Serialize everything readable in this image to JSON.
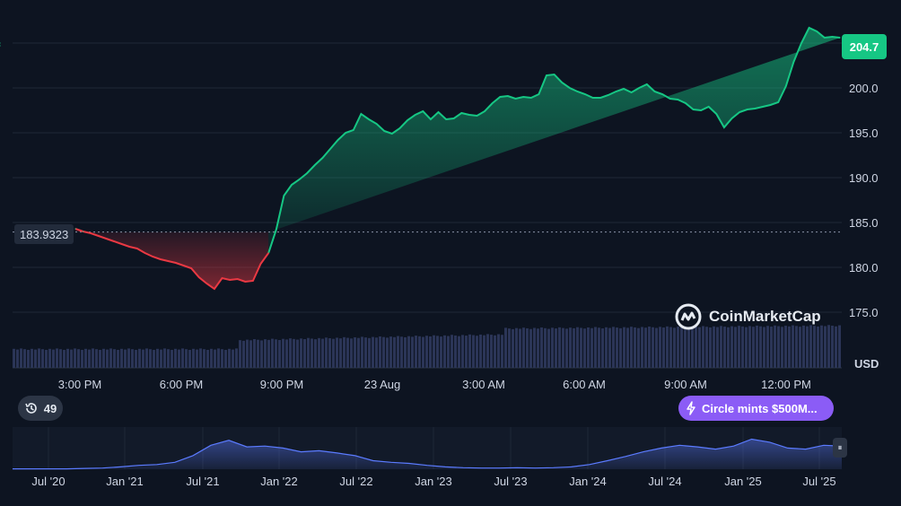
{
  "chart_data": {
    "type": "area",
    "title": "",
    "xlabel": "",
    "ylabel": "USD",
    "x_ticks": [
      "3:00 PM",
      "6:00 PM",
      "9:00 PM",
      "23 Aug",
      "3:00 AM",
      "6:00 AM",
      "9:00 AM",
      "12:00 PM"
    ],
    "y_ticks": [
      175.0,
      180.0,
      185.0,
      190.0,
      195.0,
      200.0
    ],
    "ylim": [
      172.0,
      206.5
    ],
    "baseline": 183.9323,
    "baseline_label": "183.9323",
    "current_price": 204.7,
    "current_price_label": "204.7",
    "grid": true,
    "colors": {
      "up": "#16c784",
      "down": "#ea3943",
      "volume": "#2e3a5e",
      "navigator": "#4a63c9"
    },
    "series": [
      {
        "name": "",
        "x_hours": [
          0,
          0.25,
          0.5,
          0.75,
          1,
          1.25,
          1.5,
          1.75,
          2,
          2.25,
          2.5,
          2.75,
          3,
          3.25,
          3.5,
          3.75,
          4,
          4.25,
          4.5,
          4.75,
          5,
          5.25,
          5.5,
          5.75,
          6,
          6.25,
          6.5,
          6.75,
          7,
          7.25,
          7.5,
          7.75,
          8,
          8.25,
          8.5,
          8.75,
          9,
          9.25,
          9.5,
          9.75,
          10,
          10.25,
          10.5,
          10.75,
          11,
          11.25,
          11.5,
          11.75,
          12,
          12.25,
          12.5,
          12.75,
          13,
          13.25,
          13.5,
          13.75,
          14,
          14.25,
          14.5,
          14.75,
          15,
          15.25,
          15.5,
          15.75,
          16,
          16.25,
          16.5,
          16.75,
          17,
          17.25,
          17.5,
          17.75,
          18,
          18.25,
          18.5,
          18.75,
          19,
          19.25,
          19.5,
          19.75,
          20,
          20.25,
          20.5,
          20.75,
          21,
          21.25,
          21.5,
          21.75,
          22,
          22.25,
          22.5,
          22.75,
          23,
          23.25,
          23.5,
          23.75,
          24,
          24.25,
          24.5,
          24.75
        ],
        "values": [
          184.3,
          184.0,
          183.8,
          183.5,
          183.2,
          182.9,
          182.6,
          182.3,
          182.1,
          181.6,
          181.2,
          180.9,
          180.7,
          180.5,
          180.2,
          179.9,
          178.9,
          178.2,
          177.6,
          178.8,
          178.6,
          178.7,
          178.4,
          178.5,
          180.4,
          181.6,
          184.2,
          188.0,
          189.2,
          189.8,
          190.5,
          191.4,
          192.2,
          193.2,
          194.2,
          195.0,
          195.3,
          197.1,
          196.5,
          196.0,
          195.2,
          194.9,
          195.5,
          196.4,
          197.0,
          197.4,
          196.5,
          197.3,
          196.5,
          196.6,
          197.2,
          197.0,
          196.9,
          197.4,
          198.3,
          199.0,
          199.1,
          198.8,
          199.0,
          198.9,
          199.3,
          201.4,
          201.5,
          200.6,
          200.0,
          199.6,
          199.3,
          198.9,
          198.9,
          199.2,
          199.6,
          199.9,
          199.5,
          200.0,
          200.4,
          199.6,
          199.3,
          198.8,
          198.7,
          198.3,
          197.6,
          197.5,
          197.9,
          197.1,
          195.6,
          196.6,
          197.3,
          197.6,
          197.7,
          197.9,
          198.1,
          198.4,
          200.2,
          202.9,
          205.0,
          206.7,
          206.3,
          205.6,
          205.7,
          205.6,
          205.0,
          204.7
        ]
      }
    ],
    "navigator": {
      "x_ticks": [
        "Jul '20",
        "Jan '21",
        "Jul '21",
        "Jan '22",
        "Jul '22",
        "Jan '23",
        "Jul '23",
        "Jan '24",
        "Jul '24",
        "Jan '25",
        "Jul '25"
      ],
      "values": [
        0.01,
        0.01,
        0.01,
        0.01,
        0.02,
        0.03,
        0.06,
        0.1,
        0.12,
        0.18,
        0.35,
        0.62,
        0.75,
        0.58,
        0.6,
        0.55,
        0.45,
        0.48,
        0.42,
        0.35,
        0.22,
        0.18,
        0.15,
        0.1,
        0.06,
        0.04,
        0.03,
        0.03,
        0.04,
        0.03,
        0.04,
        0.06,
        0.12,
        0.22,
        0.33,
        0.45,
        0.55,
        0.62,
        0.58,
        0.52,
        0.6,
        0.78,
        0.7,
        0.55,
        0.52,
        0.62,
        0.6
      ]
    }
  },
  "labels": {
    "unit": "USD",
    "logo_text": "CoinMarketCap",
    "history_count": "49",
    "event": "Circle mints $500M..."
  },
  "icons": {
    "history": "history-icon",
    "event": "lightning-icon",
    "logo": "cmc-logo-icon",
    "handle": "pause-handle-icon"
  }
}
